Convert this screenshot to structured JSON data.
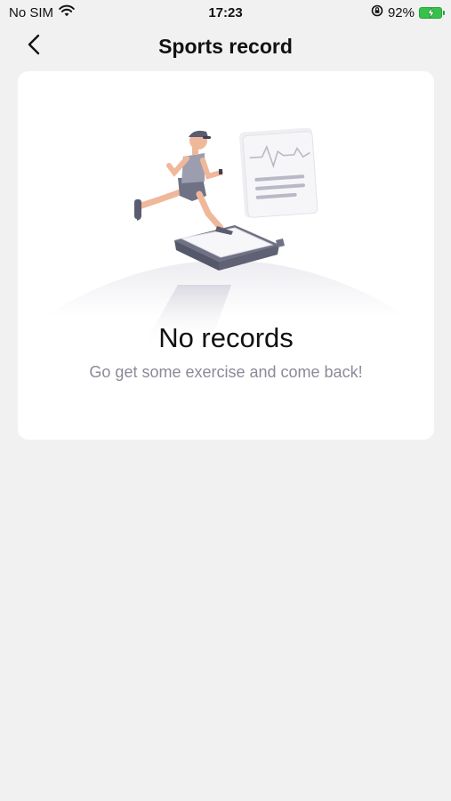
{
  "status_bar": {
    "carrier": "No SIM",
    "time": "17:23",
    "battery_percent": "92%"
  },
  "nav": {
    "title": "Sports record",
    "back_icon": "chevron-left-icon"
  },
  "empty_state": {
    "title": "No records",
    "subtitle": "Go get some exercise and come back!",
    "illustration": "runner-on-smartwatch-illustration"
  },
  "colors": {
    "background": "#f1f1f1",
    "card": "#ffffff",
    "subtitle_text": "#8a8a99",
    "battery": "#36c24a"
  }
}
